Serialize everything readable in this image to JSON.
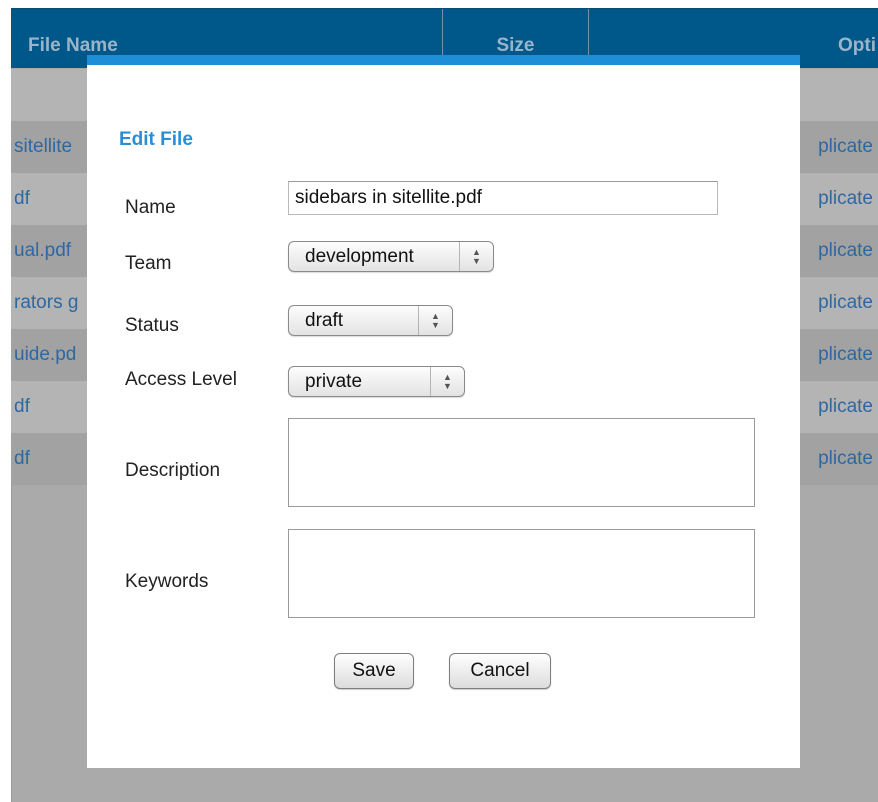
{
  "table": {
    "headers": {
      "name": "File Name",
      "size": "Size",
      "options": "Opti"
    },
    "rows": [
      {
        "name": "",
        "action": ""
      },
      {
        "name": "sitellite",
        "action": "plicate"
      },
      {
        "name": "df",
        "action": "plicate"
      },
      {
        "name": "ual.pdf",
        "action": "plicate"
      },
      {
        "name": "rators g",
        "action": "plicate"
      },
      {
        "name": "uide.pd",
        "action": "plicate"
      },
      {
        "name": "df",
        "action": "plicate"
      },
      {
        "name": "df",
        "action": "plicate"
      }
    ]
  },
  "modal": {
    "title": "Edit File",
    "fields": {
      "name": {
        "label": "Name",
        "value": "sidebars in sitellite.pdf"
      },
      "team": {
        "label": "Team",
        "value": "development"
      },
      "status": {
        "label": "Status",
        "value": "draft"
      },
      "access": {
        "label": "Access Level",
        "value": "private"
      },
      "description": {
        "label": "Description",
        "value": ""
      },
      "keywords": {
        "label": "Keywords",
        "value": ""
      }
    },
    "buttons": {
      "save": "Save",
      "cancel": "Cancel"
    }
  },
  "colors": {
    "accent": "#1e8fd6",
    "header_bg": "#00578a",
    "link": "#2d68a0"
  },
  "icons": {
    "select_arrows": "updown-chevron-icon"
  }
}
